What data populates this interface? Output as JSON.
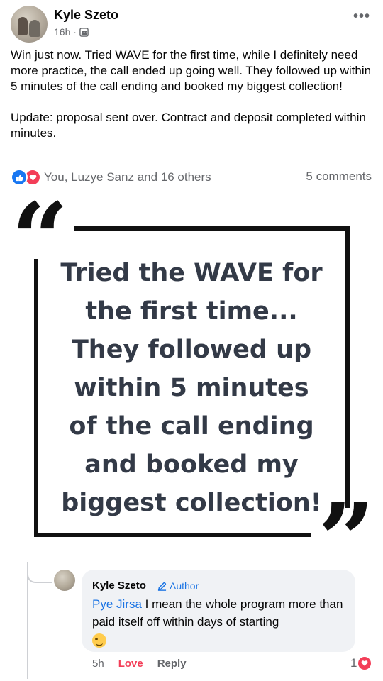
{
  "post": {
    "author": "Kyle Szeto",
    "time": "16h ·",
    "audience_icon": "friends-icon",
    "more_icon": "more-horizontal-icon",
    "paragraph_1": "Win just now. Tried WAVE for the first time, while I definitely need more practice, the call ended up going well. They followed up within 5 minutes of the call ending and booked my biggest collection!",
    "paragraph_2": "Update: proposal sent over. Contract and deposit completed within minutes.",
    "reactions_text": "You, Luzye Sanz and 16 others",
    "comments_text": "5 comments"
  },
  "quote": {
    "open_mark": "“",
    "close_mark": "”",
    "lines": [
      "Tried the WAVE for",
      "the first time...",
      "They followed up",
      "within 5 minutes",
      "of the call ending",
      "and booked my",
      "biggest collection!"
    ]
  },
  "comment": {
    "author": "Kyle Szeto",
    "author_badge": "Author",
    "tag": "Pye Jirsa",
    "text": " I mean the whole program more than paid itself off within days of starting",
    "time": "5h",
    "love_label": "Love",
    "reply_label": "Reply",
    "reaction_count": "1"
  },
  "colors": {
    "brand_blue": "#1877f2",
    "love_red": "#f33e58",
    "quote_text": "#333a47"
  }
}
